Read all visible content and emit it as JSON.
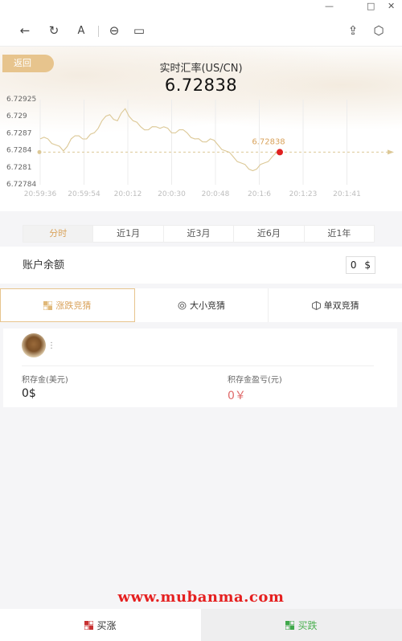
{
  "window": {
    "minimize": "—",
    "maximize": "□",
    "close": "✕"
  },
  "toolbar": {
    "back_icon": "←",
    "refresh_icon": "↻",
    "font_icon": "A",
    "link_icon": "⊖",
    "window_icon": "▭",
    "share_icon": "⇪",
    "cube_icon": "⬡"
  },
  "header": {
    "back_label": "返回",
    "title": "实时汇率(US/CN)",
    "rate": "6.72838"
  },
  "chart_data": {
    "type": "line",
    "y_ticks": [
      "6.72925",
      "6.729",
      "6.7287",
      "6.7284",
      "6.7281",
      "6.72784"
    ],
    "x_ticks": [
      "20:59:36",
      "20:59:54",
      "20:0:12",
      "20:0:30",
      "20:0:48",
      "20:1:6",
      "20:1:23",
      "20:1:41"
    ],
    "current_value": 6.72838,
    "current_label": "6.72838",
    "ylim": [
      6.72784,
      6.72925
    ],
    "grid": "vertical",
    "line_color": "#dcc896",
    "marker_color": "#e02020",
    "series": [
      {
        "values": [
          6.7286,
          6.7286,
          6.7285,
          6.7284,
          6.7286,
          6.72865,
          6.7286,
          6.7287,
          6.7289,
          6.729,
          6.7289,
          6.7291,
          6.7289,
          6.7288,
          6.72875,
          6.7288,
          6.7288,
          6.7287,
          6.72875,
          6.7287,
          6.7286,
          6.72855,
          6.7286,
          6.7285,
          6.7284,
          6.7283,
          6.7282,
          6.7281,
          6.7281,
          6.7282,
          6.7283,
          6.72838
        ]
      }
    ]
  },
  "periods": [
    {
      "label": "分时",
      "active": true
    },
    {
      "label": "近1月",
      "active": false
    },
    {
      "label": "近3月",
      "active": false
    },
    {
      "label": "近6月",
      "active": false
    },
    {
      "label": "近1年",
      "active": false
    }
  ],
  "account": {
    "label": "账户余额",
    "amount": "0",
    "currency": "$"
  },
  "modes": [
    {
      "label": "涨跌竞猜",
      "active": true
    },
    {
      "label": "大小竞猜",
      "active": false
    },
    {
      "label": "单双竞猜",
      "active": false
    }
  ],
  "card": {
    "dots": "⋮",
    "stake_label": "积存金(美元)",
    "stake_value": "0$",
    "pnl_label": "积存金盈亏(元)",
    "pnl_value": "0￥",
    "pnl_color": "#e06a6a"
  },
  "watermark": "www.mubanma.com",
  "actions": {
    "buy_up": "买涨",
    "buy_down": "买跌"
  }
}
